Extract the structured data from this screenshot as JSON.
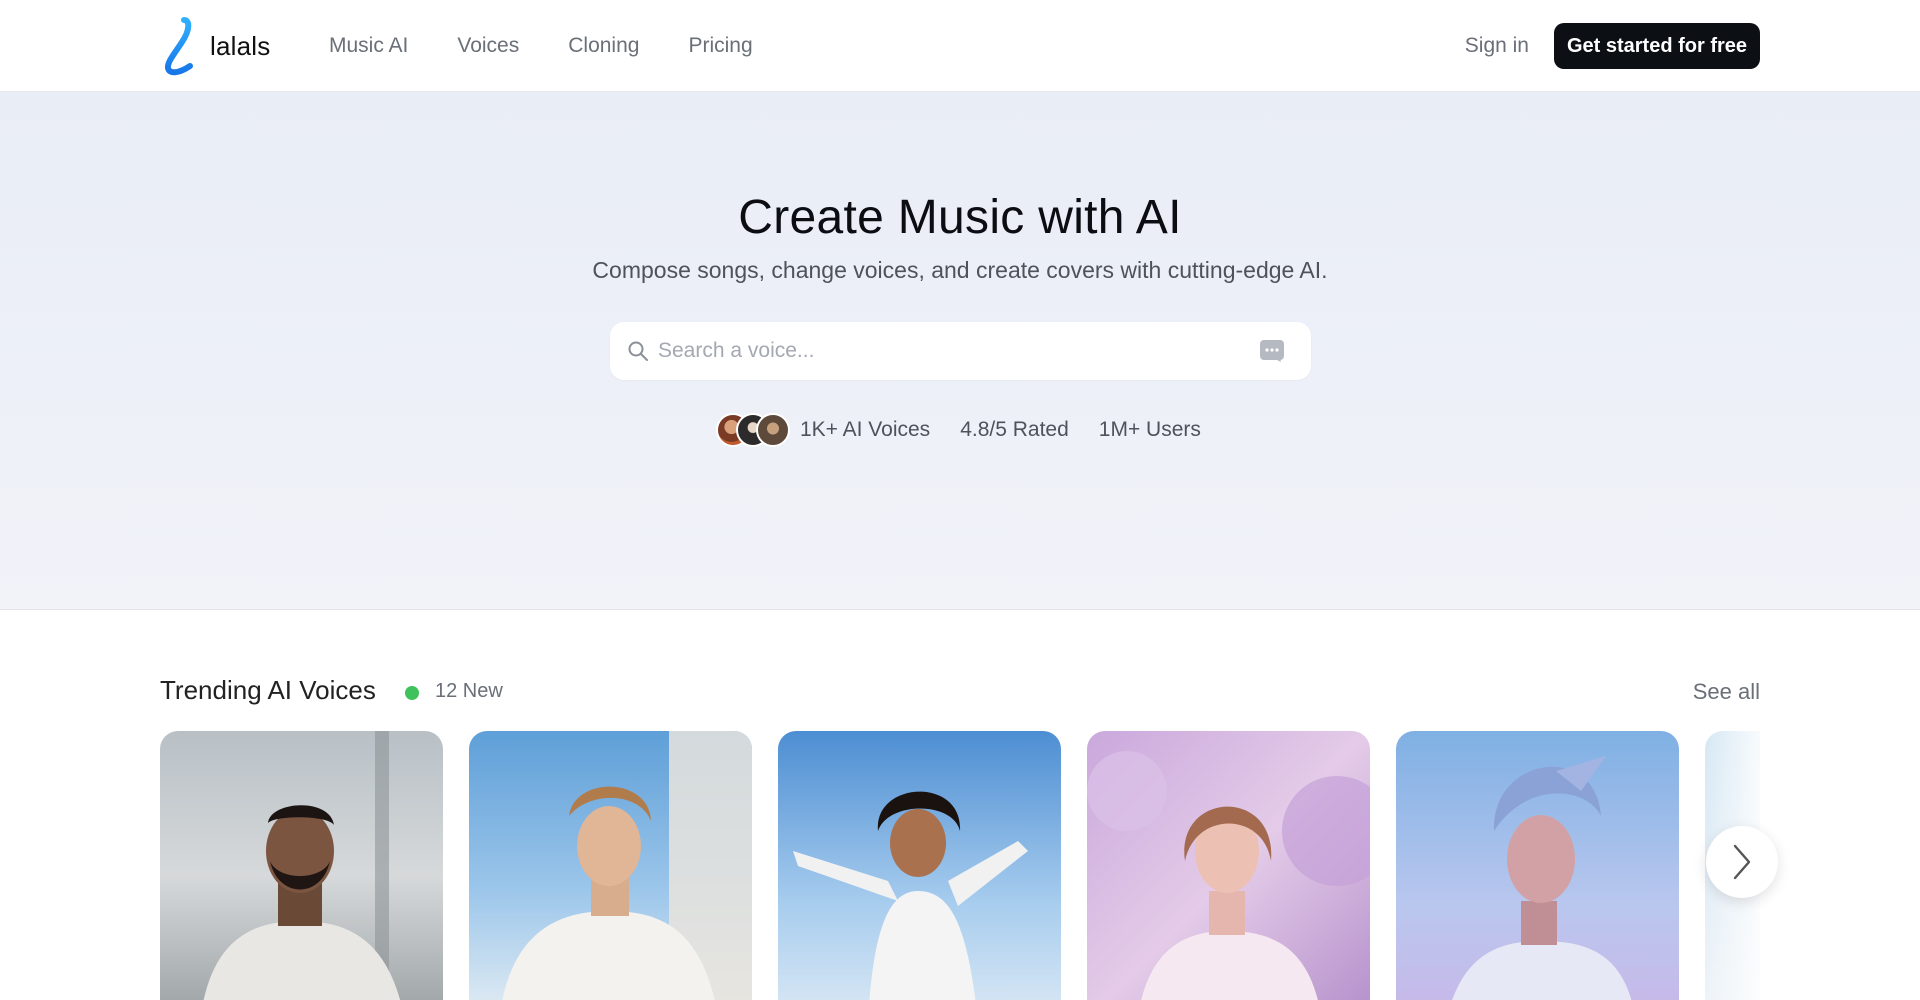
{
  "brand": {
    "name": "lalals",
    "accent": "#1a9bf0"
  },
  "nav": {
    "items": [
      {
        "label": "Music AI"
      },
      {
        "label": "Voices"
      },
      {
        "label": "Cloning"
      },
      {
        "label": "Pricing"
      }
    ]
  },
  "auth": {
    "signin_label": "Sign in",
    "cta_label": "Get started for free"
  },
  "hero": {
    "title": "Create Music with AI",
    "subtitle": "Compose songs, change voices, and create covers with cutting-edge AI.",
    "search": {
      "placeholder": "Search a voice...",
      "value": ""
    },
    "stats": {
      "voices": "1K+ AI Voices",
      "rating": "4.8/5 Rated",
      "users": "1M+ Users"
    }
  },
  "trending": {
    "title": "Trending AI Voices",
    "new_label": "12 New",
    "see_all_label": "See all",
    "status_color": "#3fc25c",
    "cards": [
      {
        "theme": "grey-sky"
      },
      {
        "theme": "blue-sky"
      },
      {
        "theme": "bright-sky"
      },
      {
        "theme": "lilac"
      },
      {
        "theme": "violet-haze"
      },
      {
        "theme": "pale-blue"
      }
    ]
  },
  "icons": {
    "search": "search-icon",
    "chat": "chat-bubble-icon",
    "next": "chevron-right-icon",
    "logo": "lalals-logo-icon"
  }
}
